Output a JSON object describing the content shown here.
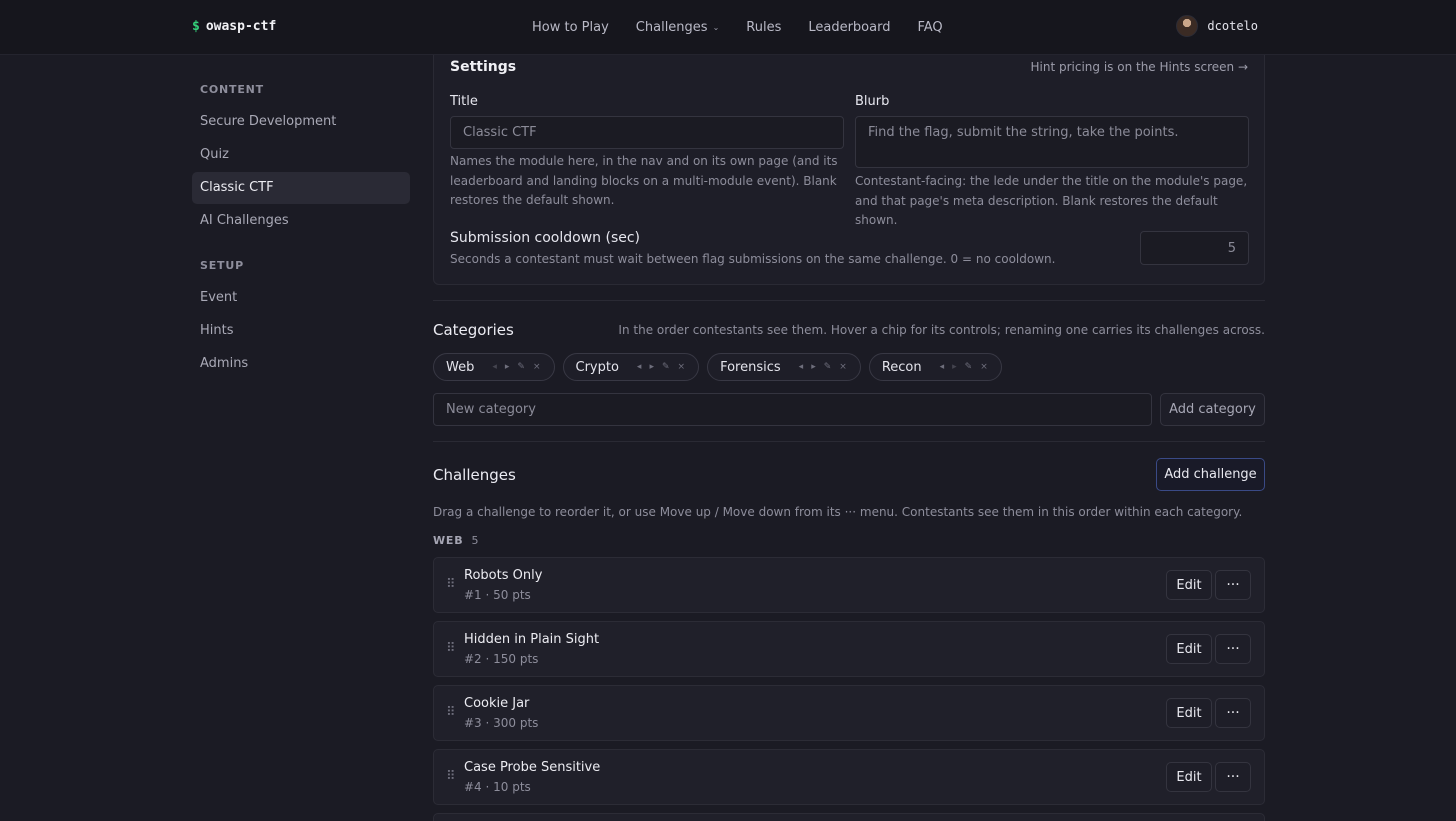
{
  "header": {
    "brand_symbol": "$",
    "brand_name": "owasp-ctf",
    "nav": [
      {
        "label": "How to Play"
      },
      {
        "label": "Challenges"
      },
      {
        "label": "Rules"
      },
      {
        "label": "Leaderboard"
      },
      {
        "label": "FAQ"
      }
    ],
    "user": "dcotelo"
  },
  "sidebar": {
    "content_heading": "CONTENT",
    "content_items": [
      "Secure Development",
      "Quiz",
      "Classic CTF",
      "AI Challenges"
    ],
    "active_item": "Classic CTF",
    "setup_heading": "SETUP",
    "setup_items": [
      "Event",
      "Hints",
      "Admins"
    ]
  },
  "settings": {
    "title": "Settings",
    "hint_link": "Hint pricing is on the Hints screen →",
    "title_label": "Title",
    "title_placeholder": "Classic CTF",
    "title_help": "Names the module here, in the nav and on its own page (and its leaderboard and landing blocks on a multi-module event). Blank restores the default shown.",
    "blurb_label": "Blurb",
    "blurb_placeholder": "Find the flag, submit the string, take the points.",
    "blurb_help": "Contestant-facing: the lede under the title on the module's page, and that page's meta description. Blank restores the default shown.",
    "cooldown_label": "Submission cooldown (sec)",
    "cooldown_help": "Seconds a contestant must wait between flag submissions on the same challenge. 0 = no cooldown.",
    "cooldown_value": "5"
  },
  "categories": {
    "title": "Categories",
    "note": "In the order contestants see them. Hover a chip for its controls; renaming one carries its challenges across.",
    "chips": [
      "Web",
      "Crypto",
      "Forensics",
      "Recon"
    ],
    "new_placeholder": "New category",
    "add_button": "Add category"
  },
  "challenges": {
    "title": "Challenges",
    "add_button": "Add challenge",
    "note": "Drag a challenge to reorder it, or use Move up / Move down from its ··· menu. Contestants see them in this order within each category.",
    "category_label": "WEB",
    "category_count": "5",
    "edit_label": "Edit",
    "more_label": "···",
    "rows": [
      {
        "title": "Robots Only",
        "meta": "#1 · 50 pts"
      },
      {
        "title": "Hidden in Plain Sight",
        "meta": "#2 · 150 pts"
      },
      {
        "title": "Cookie Jar",
        "meta": "#3 · 300 pts"
      },
      {
        "title": "Case Probe Sensitive",
        "meta": "#4 · 10 pts"
      }
    ]
  }
}
